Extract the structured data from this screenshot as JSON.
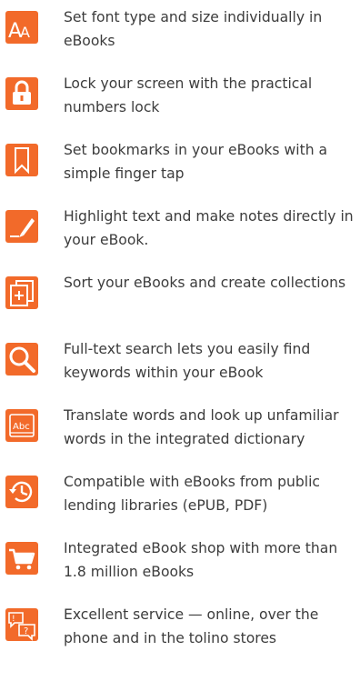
{
  "accent_color": "#f26a2a",
  "features": [
    {
      "icon": "font-size-icon",
      "text": "Set font type and size individually in eBooks"
    },
    {
      "icon": "lock-icon",
      "text": "Lock your screen with the practical numbers lock"
    },
    {
      "icon": "bookmark-icon",
      "text": "Set bookmarks in your eBooks with a simple finger tap"
    },
    {
      "icon": "highlight-pen-icon",
      "text": "Highlight text and make notes directly in your eBook."
    },
    {
      "icon": "collections-icon",
      "text": "Sort your eBooks and create collections"
    },
    {
      "icon": "search-icon",
      "text": "Full-text search lets you easily find keywords within your eBook"
    },
    {
      "icon": "dictionary-icon",
      "icon_label": "Abc",
      "text": "Translate words and look up unfamiliar words in the integrated dictionary"
    },
    {
      "icon": "history-clock-icon",
      "text": "Compatible with eBooks from public lending libraries (ePUB, PDF)"
    },
    {
      "icon": "shopping-cart-icon",
      "text": "Integrated eBook shop with more than 1.8 million eBooks"
    },
    {
      "icon": "support-chat-icon",
      "text": "Excellent service — online, over the phone and in the tolino stores"
    }
  ]
}
